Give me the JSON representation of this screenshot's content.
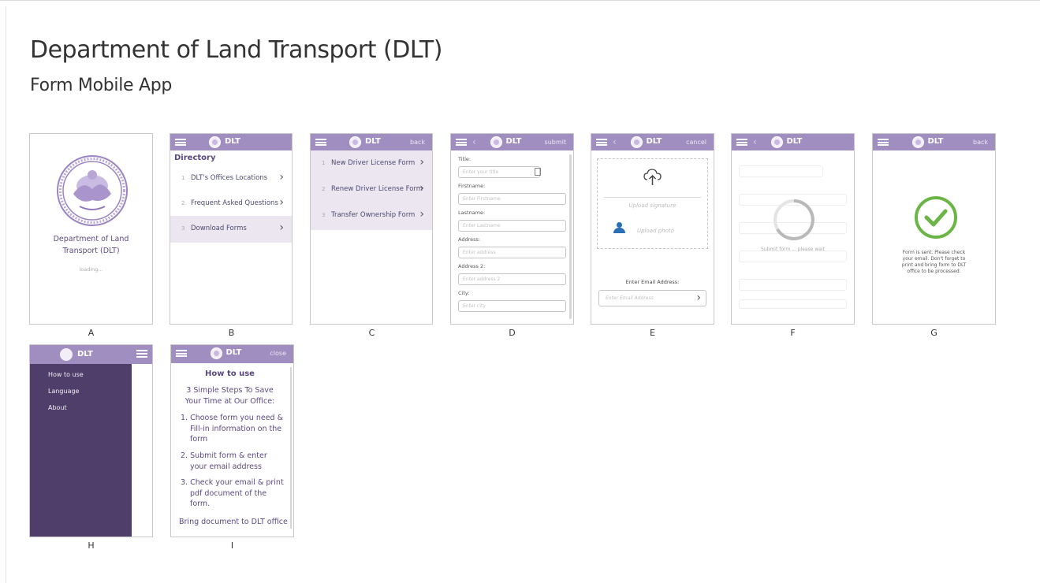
{
  "page": {
    "title": "Department of Land Transport (DLT)",
    "subtitle": "Form Mobile App"
  },
  "captions": [
    "A",
    "B",
    "C",
    "D",
    "E",
    "F",
    "G",
    "H",
    "I"
  ],
  "colors": {
    "header": "#a08ec0",
    "drawer": "#503e6a",
    "highlight": "#ebe6f0",
    "success": "#6ab546"
  },
  "app": {
    "brand": "DLT"
  },
  "screenA": {
    "org_name_line1": "Department of Land",
    "org_name_line2": "Transport (DLT)",
    "status": "loading..."
  },
  "screenB": {
    "heading": "Directory",
    "items": [
      {
        "num": "1",
        "label": "DLT's Offices Locations"
      },
      {
        "num": "2",
        "label": "Frequent Asked Questions"
      },
      {
        "num": "3",
        "label": "Download Forms"
      }
    ]
  },
  "screenC": {
    "action": "back",
    "items": [
      {
        "num": "1",
        "label": "New Driver License Form"
      },
      {
        "num": "2",
        "label": "Renew Driver License Form"
      },
      {
        "num": "3",
        "label": "Transfer Ownership Form"
      }
    ]
  },
  "screenD": {
    "action": "submit",
    "fields": [
      {
        "label": "Title:",
        "placeholder": "Enter your title"
      },
      {
        "label": "Firstname:",
        "placeholder": "Enter Firstname"
      },
      {
        "label": "Lastname:",
        "placeholder": "Enter Lastname"
      },
      {
        "label": "Address:",
        "placeholder": "Enter address"
      },
      {
        "label": "Address 2:",
        "placeholder": "Enter address 2"
      },
      {
        "label": "City:",
        "placeholder": "Enter city"
      }
    ]
  },
  "screenE": {
    "action": "cancel",
    "upload_signature": "Upload signature",
    "upload_photo": "Upload photo",
    "email_label": "Enter Email Address:",
    "email_placeholder": "Enter Email Address"
  },
  "screenF": {
    "status": "Submit form ... please wait"
  },
  "screenG": {
    "action": "back",
    "message_lines": [
      "Form is sent. Please check",
      "your email. Don't forget to",
      "print and bring form to DLT",
      "office to be processed."
    ]
  },
  "screenH": {
    "items": [
      "How to use",
      "Language",
      "About"
    ]
  },
  "screenI": {
    "action": "close",
    "heading": "How to use",
    "intro_line1": "3 Simple Steps To Save",
    "intro_line2": "Your Time at Our Office:",
    "steps": [
      {
        "lines": [
          "1. Choose form you need &",
          "Fill-in information on the",
          "form"
        ]
      },
      {
        "lines": [
          "2. Submit form & enter",
          "your email address"
        ]
      },
      {
        "lines": [
          "3. Check your email & print",
          "pdf document of the",
          "form."
        ]
      }
    ],
    "footer": "Bring document to DLT office"
  }
}
